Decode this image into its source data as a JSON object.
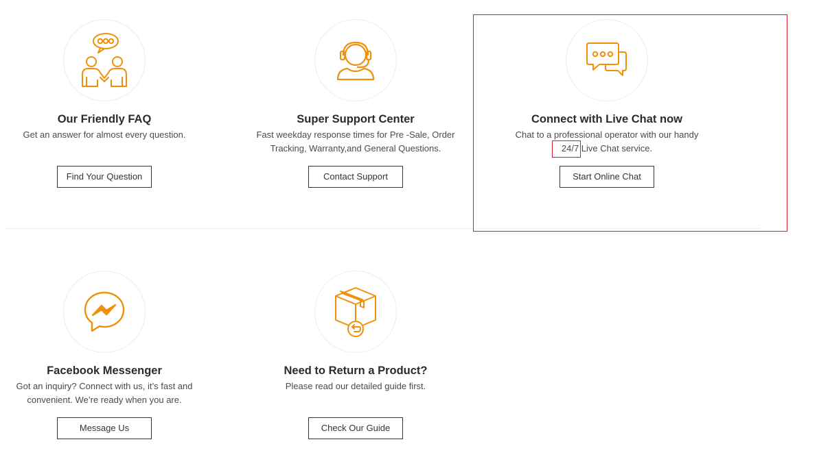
{
  "accent_color": "#f0900a",
  "cards": {
    "faq": {
      "icon": "faq-people-chat-icon",
      "title": "Our Friendly FAQ",
      "desc": "Get an answer for almost every question.",
      "button": "Find Your Question"
    },
    "support": {
      "icon": "headset-agent-icon",
      "title": "Super Support Center",
      "desc_line1": "Fast weekday response times for Pre -Sale, Order",
      "desc_line2": "Tracking, Warranty,and General Questions.",
      "button": "Contact Support"
    },
    "livechat": {
      "icon": "chat-bubbles-icon",
      "title": "Connect with Live Chat now",
      "desc_line1": "Chat to a professional operator with our handy",
      "desc_highlight": "24/7",
      "desc_line2_rest": " Live Chat service.",
      "button": "Start Online Chat"
    },
    "messenger": {
      "icon": "messenger-icon",
      "title": "Facebook Messenger",
      "desc_line1": "Got an inquiry? Connect with us, it’s fast and",
      "desc_line2": "convenient. We’re ready when you are.",
      "button": "Message Us"
    },
    "returns": {
      "icon": "return-box-icon",
      "title": "Need to Return a Product?",
      "desc": "Please read our detailed guide first.",
      "button": "Check Our Guide"
    }
  }
}
